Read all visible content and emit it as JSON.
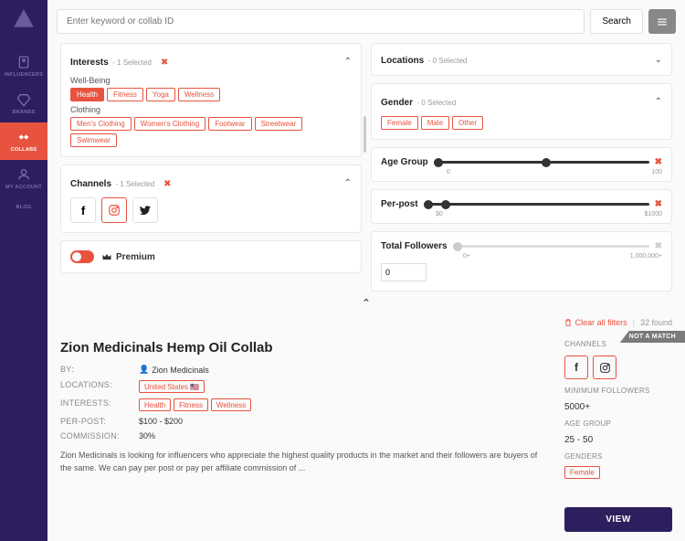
{
  "sidebar": {
    "items": [
      {
        "label": "INFLUENCERS",
        "icon": "user"
      },
      {
        "label": "BRANDS",
        "icon": "diamond"
      },
      {
        "label": "COLLABS",
        "icon": "handshake"
      },
      {
        "label": "MY ACCOUNT",
        "icon": "account"
      },
      {
        "label": "BLOG",
        "icon": ""
      }
    ]
  },
  "search": {
    "placeholder": "Enter keyword or collab ID",
    "button": "Search"
  },
  "filters": {
    "interests": {
      "title": "Interests",
      "selected_text": "1 Selected",
      "groups": [
        {
          "label": "Well-Being",
          "tags": [
            "Health",
            "Fitness",
            "Yoga",
            "Wellness"
          ],
          "filled_index": 0
        },
        {
          "label": "Clothing",
          "tags": [
            "Men's Clothing",
            "Women's Clothing",
            "Footwear",
            "Streetwear",
            "Swimwear"
          ],
          "filled_index": -1
        }
      ]
    },
    "channels": {
      "title": "Channels",
      "selected_text": "1 Selected"
    },
    "premium": {
      "label": "Premium"
    },
    "locations": {
      "title": "Locations",
      "selected_text": "0 Selected"
    },
    "gender": {
      "title": "Gender",
      "selected_text": "0 Selected",
      "options": [
        "Female",
        "Male",
        "Other"
      ]
    },
    "age_group": {
      "title": "Age Group",
      "min": "0",
      "max": "100"
    },
    "per_post": {
      "title": "Per-post",
      "min": "$0",
      "max": "$1000"
    },
    "total_followers": {
      "title": "Total Followers",
      "min": "0+",
      "max": "1,000,000+",
      "value": "0"
    }
  },
  "meta": {
    "clear_all": "Clear all filters",
    "count": "32 found"
  },
  "result": {
    "title": "Zion Medicinals Hemp Oil Collab",
    "not_match": "NOT A MATCH",
    "by_label": "BY:",
    "by_value": "Zion Medicinals",
    "locations_label": "LOCATIONS:",
    "locations_value": "United States 🇺🇸",
    "interests_label": "INTERESTS:",
    "interests": [
      "Health",
      "Fitness",
      "Wellness"
    ],
    "per_post_label": "PER-POST:",
    "per_post_value": "$100 - $200",
    "commission_label": "COMMISSION:",
    "commission_value": "30%",
    "description": "Zion Medicinals is looking for influencers who appreciate the highest quality products in the market and their followers are buyers of the same. We can pay per post or pay per affiliate commission of  ...",
    "side": {
      "channels_label": "CHANNELS",
      "min_followers_label": "MINIMUM FOLLOWERS",
      "min_followers_value": "5000+",
      "age_group_label": "AGE GROUP",
      "age_group_value": "25 - 50",
      "genders_label": "GENDERS",
      "genders": [
        "Female"
      ],
      "view": "VIEW"
    }
  }
}
